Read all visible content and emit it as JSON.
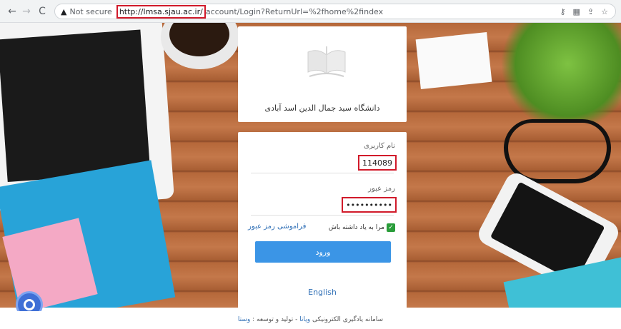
{
  "browser": {
    "warning_icon": "warning-triangle-icon",
    "not_secure": "Not secure",
    "url_host": "http://lmsa.sjau.ac.ir/",
    "url_path": "account/Login?ReturnUrl=%2fhome%2findex",
    "icons": [
      "key-icon",
      "translate-icon",
      "share-icon",
      "star-icon"
    ]
  },
  "logo": {
    "icon": "open-book-logo",
    "university_name": "دانشگاه سید جمال الدین اسد آبادی"
  },
  "login": {
    "username_label": "نام کاربری",
    "username_value": "114089",
    "password_label": "رمز عبور",
    "password_value": "••••••••••",
    "remember_label": "مرا به یاد داشته باش",
    "remember_checked": true,
    "forgot_label": "فراموشی رمز عبور",
    "submit_label": "ورود",
    "language_link": "English"
  },
  "footer": {
    "text_prefix": "سامانه یادگیری الکترونیکی",
    "brand1": "ویانا",
    "text_mid": " - تولید و توسعه : ",
    "brand2": "وستا"
  },
  "colors": {
    "accent": "#3b95e6",
    "highlight": "#d11a2a",
    "link": "#2f6fb6"
  }
}
